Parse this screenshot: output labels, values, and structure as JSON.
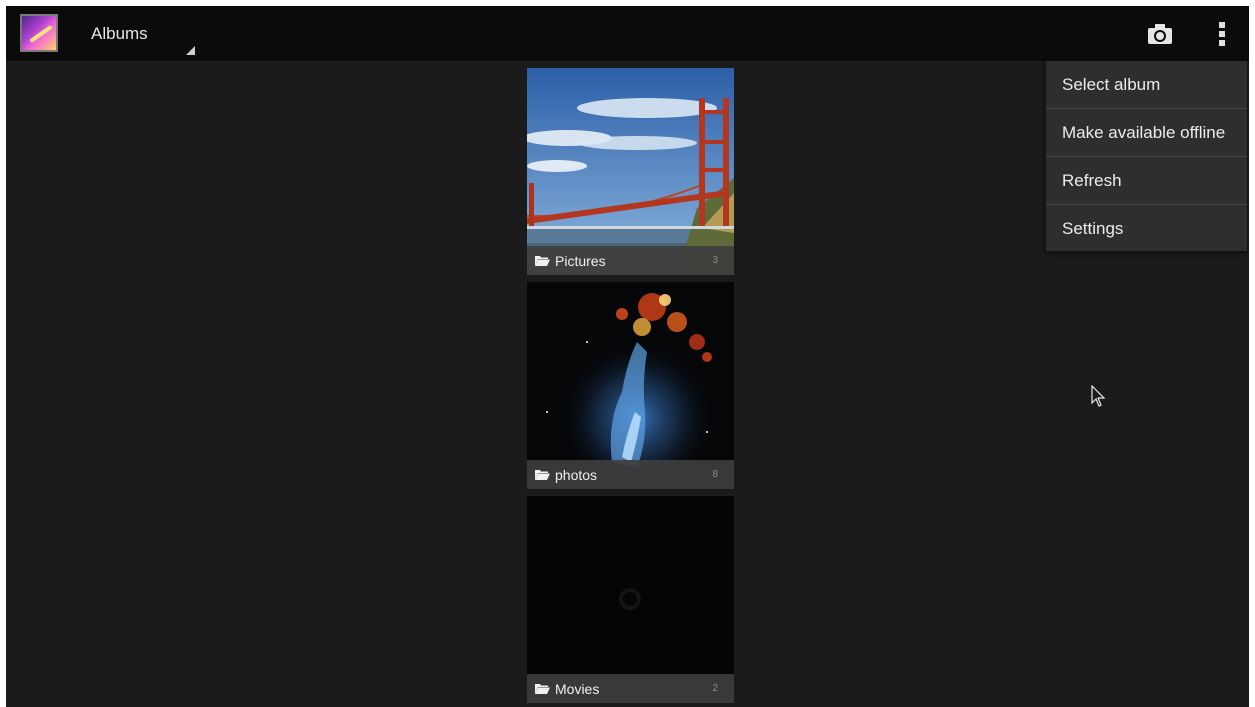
{
  "action_bar": {
    "title": "Albums",
    "app_icon": "gallery-icon",
    "actions": [
      {
        "icon": "camera-icon"
      },
      {
        "icon": "overflow-menu-icon"
      }
    ]
  },
  "albums": [
    {
      "name": "Pictures",
      "count": "3",
      "thumbnail": "golden-gate-bridge"
    },
    {
      "name": "photos",
      "count": "8",
      "thumbnail": "nebula-hand"
    },
    {
      "name": "Movies",
      "count": "2",
      "thumbnail": "loading-dark"
    }
  ],
  "overflow_menu": {
    "items": [
      {
        "label": "Select album"
      },
      {
        "label": "Make available offline"
      },
      {
        "label": "Refresh"
      },
      {
        "label": "Settings"
      }
    ]
  },
  "colors": {
    "action_bar_bg": "#0b0b0b",
    "content_bg": "#1b1b1b",
    "menu_bg": "#2e2e2e",
    "label_bg": "#3e3e3e"
  }
}
